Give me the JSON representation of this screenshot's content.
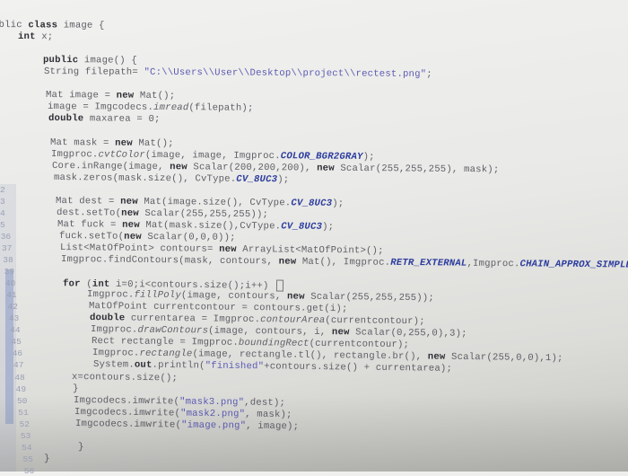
{
  "editor": {
    "colors": {
      "keyword": "#2e2e36",
      "string": "#5a5ab4",
      "constant": "#2c3c9e",
      "text": "#5e5e66",
      "gutter_marker": "#8a9ac8"
    },
    "lines": [
      {
        "col": 0,
        "text": "ublic class image {"
      },
      {
        "col": 4,
        "text": "int x;"
      },
      {
        "col": 0,
        "text": ""
      },
      {
        "col": 8,
        "text": "public image() {"
      },
      {
        "col": 8,
        "text": "String filepath= \"C:\\\\Users\\\\User\\\\Desktop\\\\project\\\\rectest.png\";"
      },
      {
        "col": 0,
        "text": ""
      },
      {
        "col": 8,
        "text": "Mat image = new Mat();"
      },
      {
        "col": 8,
        "text": "image = Imgcodecs.imread(filepath);"
      },
      {
        "col": 8,
        "text": "double maxarea = 0;"
      },
      {
        "col": 0,
        "text": ""
      },
      {
        "col": 8,
        "text": "Mat mask = new Mat();"
      },
      {
        "col": 8,
        "text": "Imgproc.cvtColor(image, image, Imgproc.COLOR_BGR2GRAY);"
      },
      {
        "col": 8,
        "text": "Core.inRange(image, new Scalar(200,200,200), new Scalar(255,255,255), mask);"
      },
      {
        "col": 8,
        "text": "mask.zeros(mask.size(), CvType.CV_8UC3);"
      },
      {
        "col": 0,
        "text": "",
        "num": "2"
      },
      {
        "col": 8,
        "text": "Mat dest = new Mat(image.size(), CvType.CV_8UC3);",
        "num": "3"
      },
      {
        "col": 8,
        "text": "dest.setTo(new Scalar(255,255,255));",
        "num": "4"
      },
      {
        "col": 8,
        "text": "Mat fuck = new Mat(mask.size(),CvType.CV_8UC3);",
        "num": "5"
      },
      {
        "col": 8,
        "text": "fuck.setTo(new Scalar(0,0,0));",
        "num": "36"
      },
      {
        "col": 8,
        "text": "List<MatOfPoint> contours= new ArrayList<MatOfPoint>();",
        "num": "37"
      },
      {
        "col": 8,
        "text": "Imgproc.findContours(mask, contours, new Mat(), Imgproc.RETR_EXTERNAL,Imgproc.CHAIN_APPROX_SIMPLE);",
        "num": "38"
      },
      {
        "col": 0,
        "text": "",
        "num": "39"
      },
      {
        "col": 8,
        "text": "for (int i=0;i<contours.size();i++) {",
        "num": "40"
      },
      {
        "col": 12,
        "text": "Imgproc.fillPoly(image, contours, new Scalar(255,255,255));",
        "num": "41"
      },
      {
        "col": 12,
        "text": "MatOfPoint currentcontour = contours.get(i);",
        "num": "42"
      },
      {
        "col": 12,
        "text": "double currentarea = Imgproc.contourArea(currentcontour);",
        "num": "43"
      },
      {
        "col": 12,
        "text": "Imgproc.drawContours(image, contours, i, new Scalar(0,255,0),3);",
        "num": "44"
      },
      {
        "col": 12,
        "text": "Rect rectangle = Imgproc.boundingRect(currentcontour);",
        "num": "45"
      },
      {
        "col": 12,
        "text": "Imgproc.rectangle(image, rectangle.tl(), rectangle.br(), new Scalar(255,0,0),1);",
        "num": "46"
      },
      {
        "col": 12,
        "text": "System.out.println(\"finished\"+contours.size() + currentarea);",
        "num": "47"
      },
      {
        "col": 8,
        "text": "x=contours.size();",
        "num": "48"
      },
      {
        "col": 8,
        "text": "}",
        "num": "49"
      },
      {
        "col": 8,
        "text": "Imgcodecs.imwrite(\"mask3.png\",dest);",
        "num": "50"
      },
      {
        "col": 8,
        "text": "Imgcodecs.imwrite(\"mask2.png\", mask);",
        "num": "51"
      },
      {
        "col": 8,
        "text": "Imgcodecs.imwrite(\"image.png\", image);",
        "num": "52"
      },
      {
        "col": 0,
        "text": "",
        "num": "53"
      },
      {
        "col": 8,
        "text": "}",
        "num": "54"
      },
      {
        "col": 2,
        "text": "}",
        "num": "55"
      },
      {
        "col": 0,
        "text": "",
        "num": "56"
      }
    ]
  }
}
